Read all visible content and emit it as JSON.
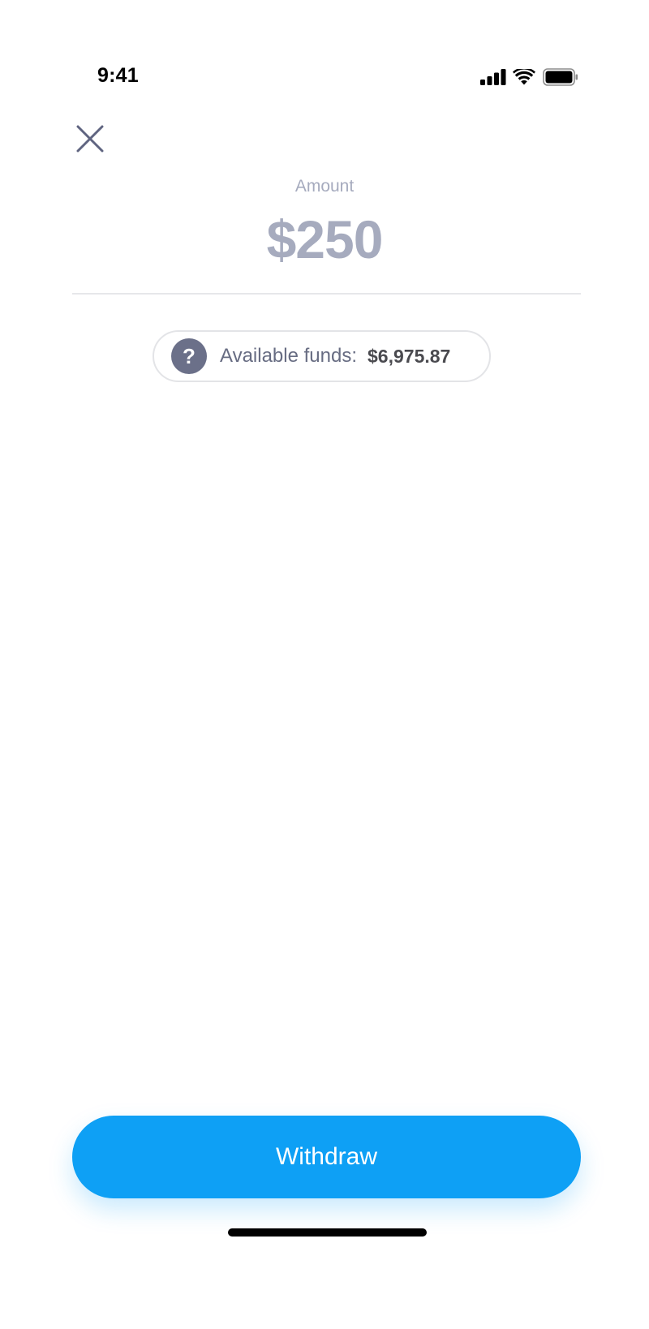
{
  "status_bar": {
    "time": "9:41",
    "icons": [
      "cellular-signal-icon",
      "wifi-icon",
      "battery-icon"
    ]
  },
  "header": {
    "close_icon": "close-icon"
  },
  "amount": {
    "label": "Amount",
    "value": "$250"
  },
  "funds": {
    "help_icon_glyph": "?",
    "label": "Available funds:",
    "value": "$6,975.87"
  },
  "actions": {
    "withdraw_label": "Withdraw"
  },
  "colors": {
    "accent": "#0ea0f5",
    "muted_text": "#a6abbe",
    "icon_gray": "#6b7089"
  }
}
